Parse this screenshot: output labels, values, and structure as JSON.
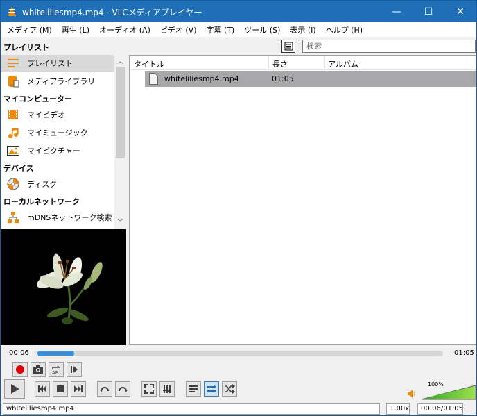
{
  "window": {
    "title": "whiteliliesmp4.mp4 - VLCメディアプレイヤー",
    "minimize": "—",
    "maximize": "☐",
    "close": "✕"
  },
  "menu": [
    "メディア (M)",
    "再生 (L)",
    "オーディオ (A)",
    "ビデオ (V)",
    "字幕 (T)",
    "ツール (S)",
    "表示 (I)",
    "ヘルプ (H)"
  ],
  "playlist_header": {
    "label": "プレイリスト",
    "search_placeholder": "検索"
  },
  "sidebar": {
    "items": [
      {
        "label": "プレイリスト",
        "icon": "playlist-icon"
      },
      {
        "label": "メディアライブラリ",
        "icon": "media-library-icon"
      },
      {
        "label": "マイビデオ",
        "icon": "film-icon"
      },
      {
        "label": "マイミュージック",
        "icon": "music-note-icon"
      },
      {
        "label": "マイピクチャー",
        "icon": "picture-icon"
      },
      {
        "label": "ディスク",
        "icon": "disc-icon"
      },
      {
        "label": "mDNSネットワーク検索",
        "icon": "network-icon"
      }
    ],
    "categories": [
      "マイコンピューター",
      "デバイス",
      "ローカルネットワーク"
    ]
  },
  "list": {
    "columns": [
      "タイトル",
      "長さ",
      "アルバム"
    ],
    "rows": [
      {
        "title": "whiteliliesmp4.mp4",
        "duration": "01:05",
        "album": ""
      }
    ]
  },
  "playback": {
    "elapsed": "00:06",
    "total": "01:05",
    "progress": 0.09
  },
  "volume": {
    "level": "100%",
    "value": 1.0
  },
  "status": {
    "file": "whiteliliesmp4.mp4",
    "speed": "1.00x",
    "time": "00:06/01:05"
  },
  "colors": {
    "titlebar": "#1f6fb8",
    "accent": "#3a8fd6",
    "vlc_orange": "#f08a00",
    "selection": "#a8a8aa"
  }
}
